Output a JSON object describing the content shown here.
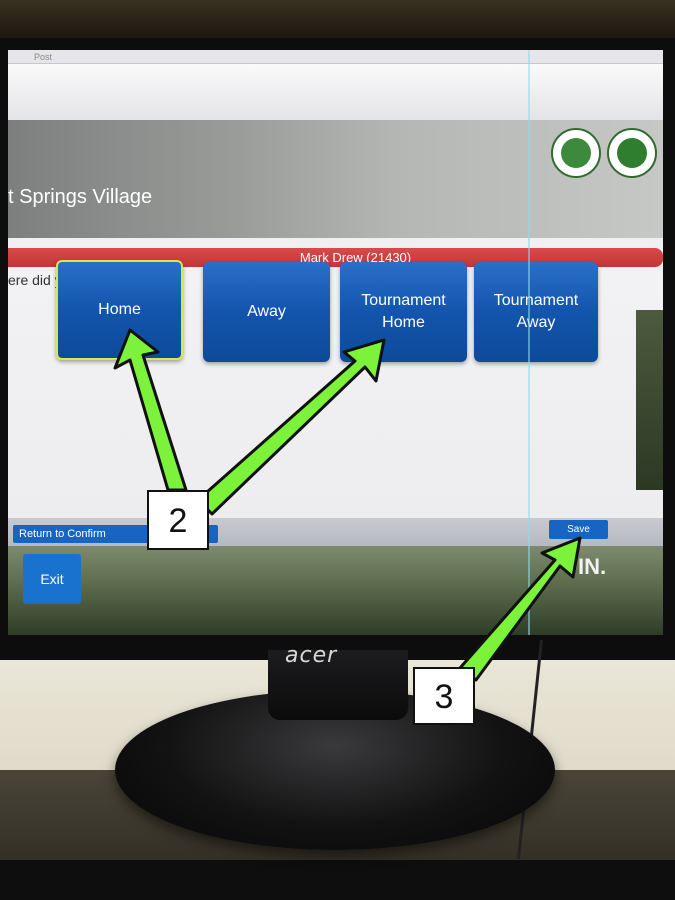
{
  "screen": {
    "window_title": "Post",
    "club_name": "t Springs Village",
    "player_banner": "Mark Drew (21430)",
    "question": "ere did you play?",
    "choices": [
      {
        "label": "Home",
        "selected": true
      },
      {
        "label": "Away"
      },
      {
        "label": "Tournament\nHome"
      },
      {
        "label": "Tournament\nAway"
      }
    ],
    "buttons": {
      "return_label": "Return to Confirm",
      "save_label": "Save",
      "exit_label": "Exit"
    },
    "corner_text": "IN."
  },
  "annotations": {
    "callout_2": "2",
    "callout_3": "3",
    "arrow_color": "#7cf23a"
  },
  "monitor": {
    "brand": "acer"
  }
}
